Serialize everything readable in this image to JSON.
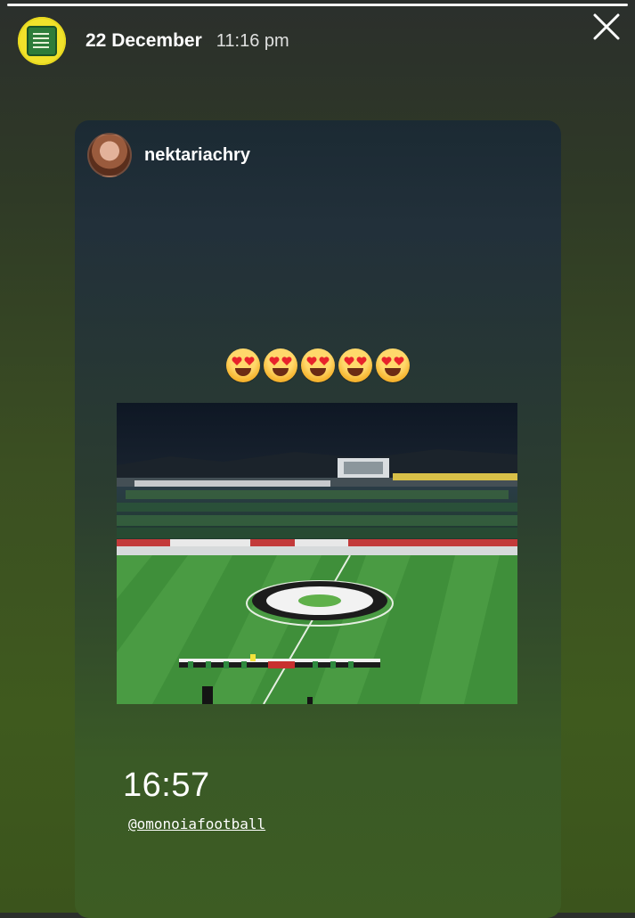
{
  "story": {
    "date": "22 December",
    "time": "11:16 pm"
  },
  "post": {
    "username": "nektariachry",
    "emojis": [
      "smiling-face-with-heart-eyes",
      "smiling-face-with-heart-eyes",
      "smiling-face-with-heart-eyes",
      "smiling-face-with-heart-eyes",
      "smiling-face-with-heart-eyes"
    ],
    "clock_sticker": "16:57",
    "mention": "@omonoiafootball"
  },
  "colors": {
    "accent_yellow": "#f1e22b",
    "pitch_green": "#3f8f3a",
    "background_green": "#3f5a1e"
  }
}
